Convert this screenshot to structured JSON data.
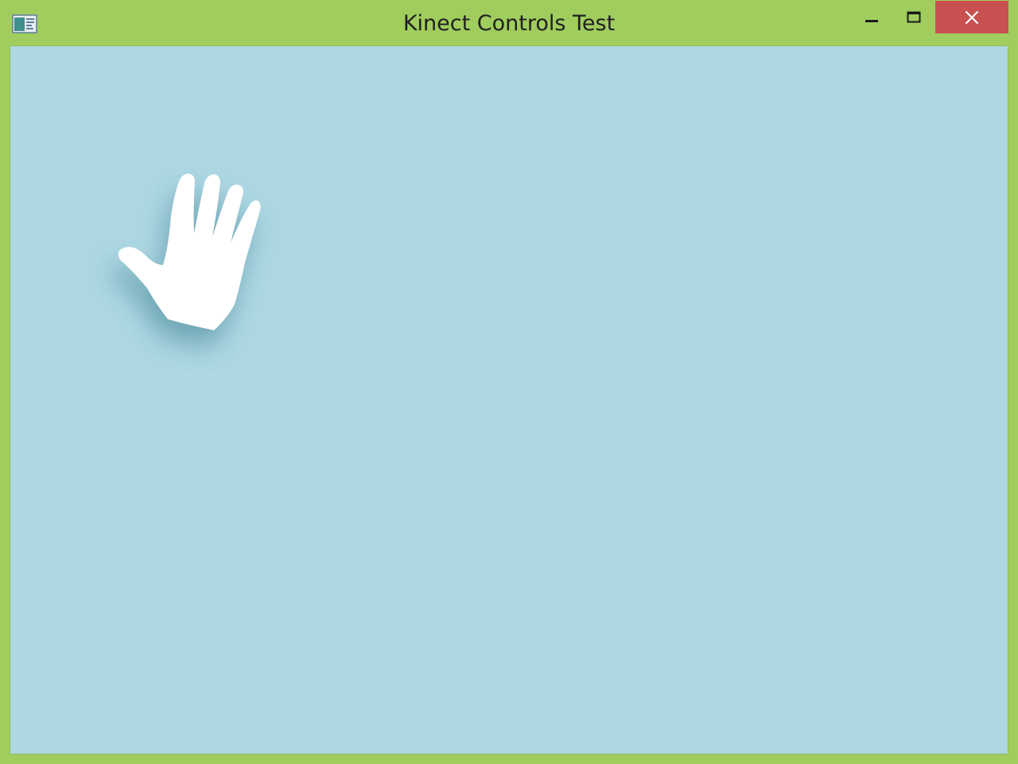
{
  "window": {
    "title": "Kinect Controls Test",
    "frame_color": "#a0cd5e",
    "client_background": "#add7e3",
    "close_button_color": "#c75050"
  },
  "titlebar": {
    "app_icon": "window-app-icon",
    "buttons": {
      "minimize_icon": "minimize-icon",
      "maximize_icon": "maximize-icon",
      "close_icon": "close-icon"
    }
  },
  "canvas": {
    "cursor_icon": "open-hand-icon"
  }
}
